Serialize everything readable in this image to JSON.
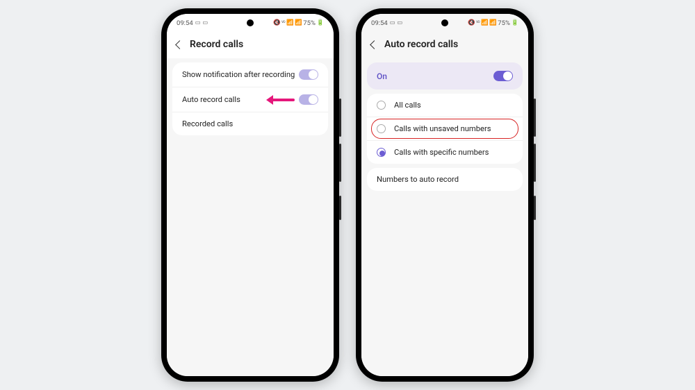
{
  "status": {
    "time": "09:54",
    "battery": "75%"
  },
  "phone1": {
    "title": "Record calls",
    "rows": {
      "notify": "Show notification after recording",
      "auto": "Auto record calls",
      "recorded": "Recorded calls"
    }
  },
  "phone2": {
    "title": "Auto record calls",
    "on": "On",
    "options": {
      "all": "All calls",
      "unsaved": "Calls with unsaved numbers",
      "specific": "Calls with specific numbers"
    },
    "numbers_section": "Numbers to auto record"
  }
}
